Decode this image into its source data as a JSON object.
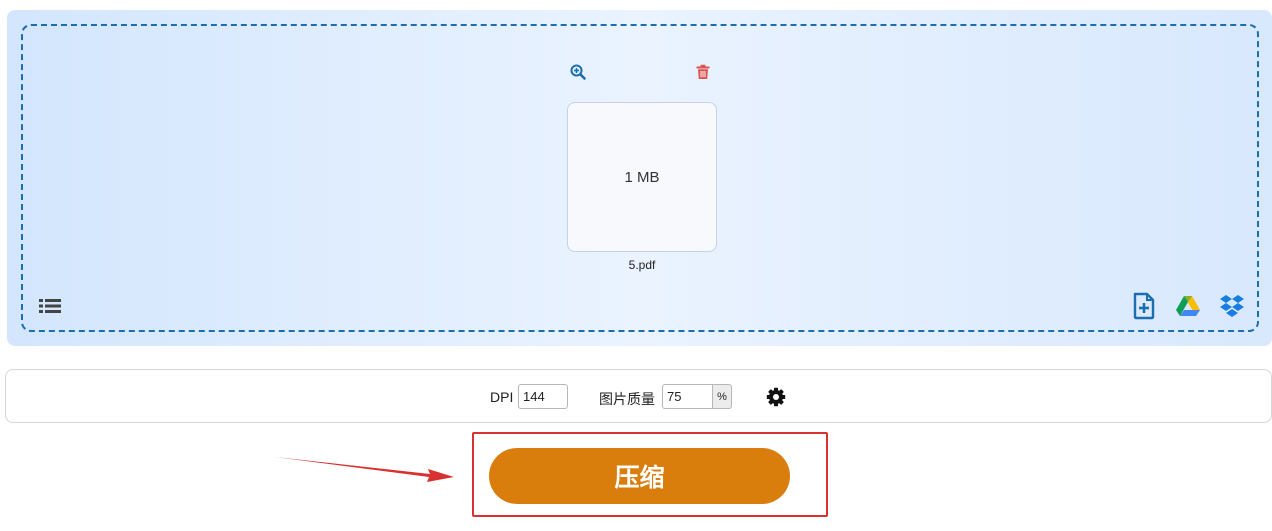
{
  "upload_area": {
    "file": {
      "size": "1 MB",
      "name": "5.pdf",
      "zoom_icon": "zoom-in-icon",
      "delete_icon": "trash-icon"
    },
    "list_icon": "list-icon",
    "sources": [
      {
        "name": "add-file-icon"
      },
      {
        "name": "google-drive-icon"
      },
      {
        "name": "dropbox-icon"
      }
    ]
  },
  "options": {
    "dpi_label": "DPI",
    "dpi_value": "144",
    "quality_label": "图片质量",
    "quality_value": "75",
    "quality_unit": "%",
    "settings_icon": "gear-icon"
  },
  "action": {
    "compress_label": "压缩"
  },
  "colors": {
    "accent_blue": "#1b6fb0",
    "delete_red": "#d9534f",
    "compress_orange": "#d97d0d",
    "annotation_red": "#d93030"
  }
}
